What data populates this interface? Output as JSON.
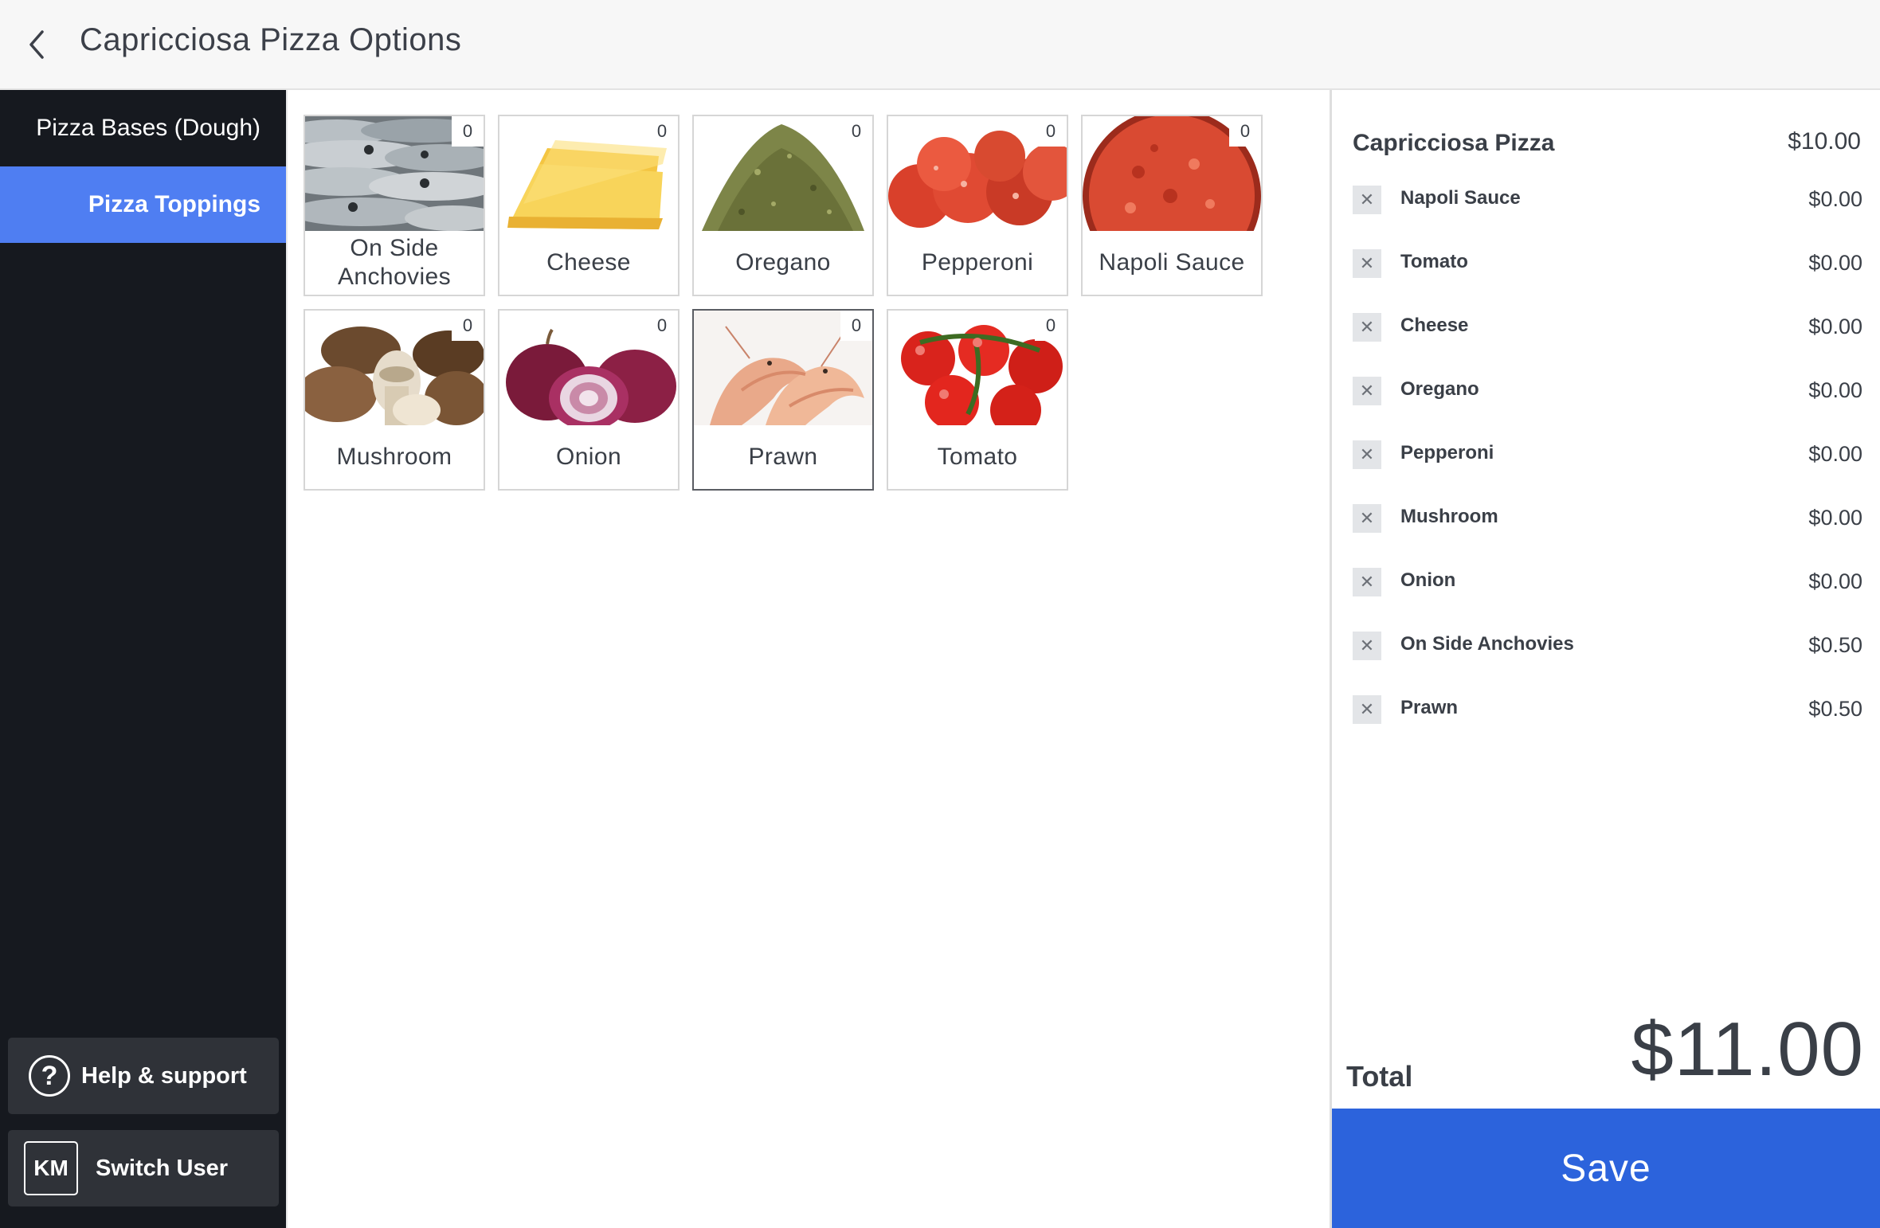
{
  "header": {
    "title": "Capricciosa Pizza Options"
  },
  "sidebar": {
    "categories": [
      {
        "label": "Pizza Bases (Dough)",
        "active": false
      },
      {
        "label": "Pizza Toppings",
        "active": true
      }
    ],
    "help_label": "Help & support",
    "help_icon": "question-mark-circle",
    "user_initials": "KM",
    "switch_user_label": "Switch User"
  },
  "grid": {
    "tiles": [
      {
        "label": "On Side Anchovies",
        "count": "0",
        "image": "anchovies"
      },
      {
        "label": "Cheese",
        "count": "0",
        "image": "cheese"
      },
      {
        "label": "Oregano",
        "count": "0",
        "image": "oregano"
      },
      {
        "label": "Pepperoni",
        "count": "0",
        "image": "pepperoni"
      },
      {
        "label": "Napoli Sauce",
        "count": "0",
        "image": "napoli-sauce"
      },
      {
        "label": "Mushroom",
        "count": "0",
        "image": "mushroom"
      },
      {
        "label": "Onion",
        "count": "0",
        "image": "onion"
      },
      {
        "label": "Prawn",
        "count": "0",
        "image": "prawn",
        "selected": true
      },
      {
        "label": "Tomato",
        "count": "0",
        "image": "tomato"
      }
    ]
  },
  "summary": {
    "item_name": "Capricciosa Pizza",
    "item_price": "$10.00",
    "modifiers": [
      {
        "name": "Napoli Sauce",
        "price": "$0.00"
      },
      {
        "name": "Tomato",
        "price": "$0.00"
      },
      {
        "name": "Cheese",
        "price": "$0.00"
      },
      {
        "name": "Oregano",
        "price": "$0.00"
      },
      {
        "name": "Pepperoni",
        "price": "$0.00"
      },
      {
        "name": "Mushroom",
        "price": "$0.00"
      },
      {
        "name": "Onion",
        "price": "$0.00"
      },
      {
        "name": "On Side Anchovies",
        "price": "$0.50"
      },
      {
        "name": "Prawn",
        "price": "$0.50"
      }
    ],
    "remove_icon": "close-x",
    "total_label": "Total",
    "total_value": "$11.00",
    "save_label": "Save"
  },
  "colors": {
    "accent_blue": "#4f7ef2",
    "save_blue": "#2c63dc",
    "sidebar_bg": "#16191f",
    "button_bg": "#2f3238"
  }
}
